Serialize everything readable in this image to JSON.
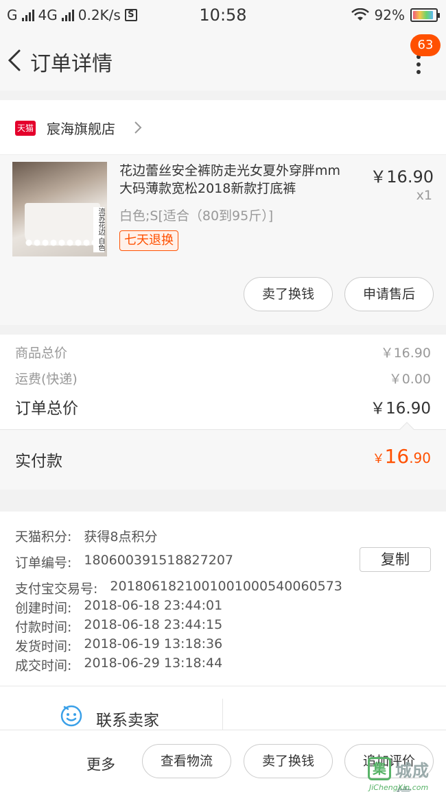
{
  "status_bar": {
    "carrier_1": "G",
    "carrier_2": "4G",
    "speed": "0.2K/s",
    "s_icon": "S",
    "time": "10:58",
    "battery": "92%"
  },
  "nav": {
    "title": "订单详情",
    "badge_count": "63"
  },
  "shop": {
    "logo_text": "天猫",
    "name": "宸海旗舰店"
  },
  "product": {
    "title": "花边蕾丝安全裤防走光女夏外穿胖mm大码薄款宽松2018新款打底裤",
    "price": "￥16.90",
    "quantity": "x1",
    "sku": "白色;S[适合（80到95斤）]",
    "image_tag": "流苏花边 白色",
    "return_tag": "七天退换",
    "buttons": [
      "卖了换钱",
      "申请售后"
    ]
  },
  "summary": {
    "goods_label": "商品总价",
    "goods_value": "￥16.90",
    "shipping_label": "运费(快递)",
    "shipping_value": "￥0.00",
    "total_label": "订单总价",
    "total_value": "￥16.90",
    "paid_label": "实付款",
    "paid_currency": "￥",
    "paid_int": "16",
    "paid_dec": ".90"
  },
  "info": {
    "points_label": "天猫积分:",
    "points_value": "获得8点积分",
    "order_no_label": "订单编号:",
    "order_no_value": "180600391518827207",
    "copy_label": "复制",
    "alipay_label": "支付宝交易号:",
    "alipay_value": "2018061821001001000540060573",
    "created_label": "创建时间:",
    "created_value": "2018-06-18 23:44:01",
    "paid_time_label": "付款时间:",
    "paid_time_value": "2018-06-18 23:44:15",
    "shipped_label": "发货时间:",
    "shipped_value": "2018-06-19 13:18:36",
    "done_label": "成交时间:",
    "done_value": "2018-06-29 13:18:44"
  },
  "contact": {
    "label": "联系卖家"
  },
  "bottom_bar": {
    "more": "更多",
    "buttons": [
      "查看物流",
      "卖了换钱",
      "追加评价"
    ]
  },
  "watermark": {
    "logo": "集",
    "name": "城成信",
    "url": "JiChengXin.com"
  },
  "colors": {
    "accent": "#ff5000",
    "tmall_red": "#e4002b",
    "contact_icon": "#3aa0e8"
  }
}
